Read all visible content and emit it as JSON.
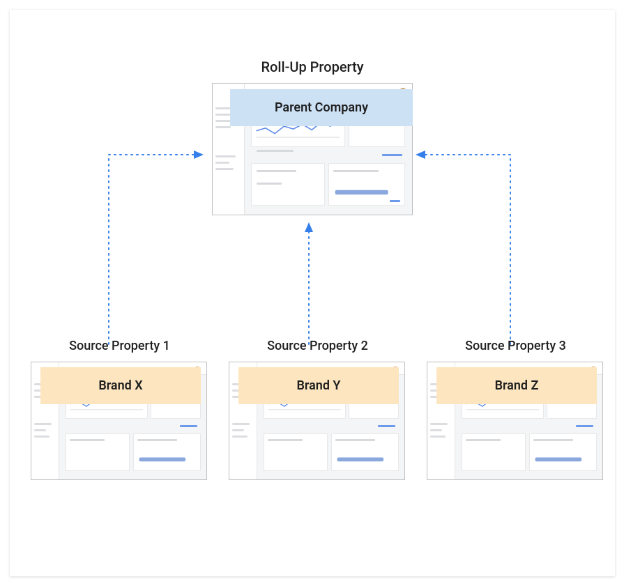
{
  "parent": {
    "title": "Roll-Up Property",
    "overlay_label": "Parent Company"
  },
  "sources": [
    {
      "title": "Source Property 1",
      "overlay_label": "Brand  X"
    },
    {
      "title": "Source Property 2",
      "overlay_label": "Brand Y"
    },
    {
      "title": "Source Property 3",
      "overlay_label": "Brand Z"
    }
  ]
}
